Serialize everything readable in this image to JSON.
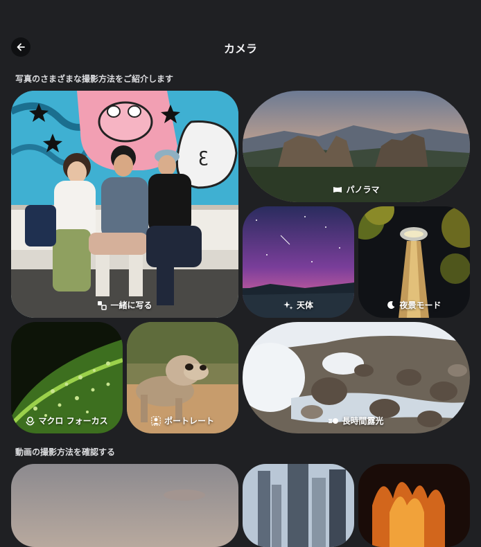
{
  "header": {
    "title": "カメラ"
  },
  "sections": {
    "photo": "写真のさまざまな撮影方法をご紹介します",
    "video": "動画の撮影方法を確認する"
  },
  "modes": {
    "together": "一緒に写る",
    "panorama": "パノラマ",
    "astro": "天体",
    "night": "夜景モード",
    "macro": "マクロ フォーカス",
    "portrait": "ポートレート",
    "long_exposure": "長時間露光"
  }
}
